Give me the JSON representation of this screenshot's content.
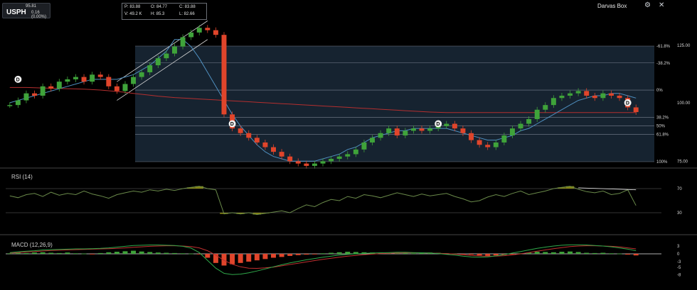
{
  "ticker": {
    "symbol": "USPH",
    "price": "95.81",
    "change": "0.16 (0.00%)"
  },
  "ohlc": {
    "p": "P: 83.88",
    "o": "O: 84.77",
    "c": "C: 83.88",
    "v": "V: 49.2 K",
    "h": "H: 85.3",
    "l": "L: 82.66"
  },
  "toolbar": {
    "indicator_name": "Darvas Box",
    "settings_icon": "gear-icon",
    "close_icon": "close-icon"
  },
  "colors": {
    "background": "#000000",
    "up_candle": "#3fa33a",
    "down_candle": "#e0452b",
    "ma_short": "#4f8fbf",
    "ma_long": "#b42f2f",
    "fib_fill": "#1c2c3c",
    "rsi_line": "#6a8a4a",
    "rsi_fill": "#9a9a16",
    "macd_line": "#2fa84a",
    "signal_line": "#c03030"
  },
  "chart_data": [
    {
      "type": "line",
      "title": "",
      "y_ticks": [
        "125.00",
        "100.00",
        "75.00"
      ],
      "fib_levels": [
        {
          "label": "-61.8%",
          "value": 123.2
        },
        {
          "label": "-38.2%",
          "value": 116.0
        },
        {
          "label": "0%",
          "value": 104.4
        },
        {
          "label": "38.2%",
          "value": 92.7
        },
        {
          "label": "50%",
          "value": 89.1
        },
        {
          "label": "61.8%",
          "value": 85.5
        },
        {
          "label": "100%",
          "value": 73.8
        }
      ],
      "close": [
        98,
        100,
        103,
        102,
        106,
        105,
        108,
        109,
        110,
        108,
        111,
        110,
        106,
        104,
        107,
        110,
        112,
        115,
        118,
        120,
        123,
        127,
        129,
        131,
        130,
        128,
        94,
        88,
        86,
        84,
        82,
        80,
        78,
        76,
        74,
        73,
        72,
        73,
        74,
        75,
        76,
        77,
        79,
        82,
        84,
        86,
        88,
        85,
        87,
        88,
        87,
        88,
        89,
        90,
        88,
        86,
        83,
        81,
        80,
        82,
        85,
        88,
        90,
        92,
        96,
        98,
        101,
        102,
        103,
        104,
        102,
        101,
        103,
        102,
        101,
        97,
        95
      ],
      "ma_short": [
        99,
        100,
        101,
        102,
        103,
        104,
        105,
        106,
        107,
        108,
        109,
        109,
        109,
        109,
        110,
        111,
        113,
        115,
        118,
        121,
        126,
        126,
        123,
        118,
        112,
        106,
        100,
        94,
        89,
        85,
        81,
        78,
        76,
        75,
        74,
        74,
        74,
        74,
        75,
        76,
        77,
        79,
        80,
        82,
        84,
        85,
        86,
        87,
        87,
        88,
        88,
        88,
        88,
        88,
        87,
        86,
        85,
        84,
        83,
        83,
        84,
        85,
        87,
        88,
        90,
        92,
        94,
        96,
        98,
        100,
        101,
        102,
        102,
        103,
        103,
        102,
        101
      ],
      "ma_long": [
        105.5,
        105.5,
        105.5,
        105.4,
        105.3,
        105.2,
        105.1,
        105.0,
        104.9,
        104.8,
        104.6,
        104.4,
        104.1,
        103.8,
        103.4,
        103.0,
        102.6,
        102.2,
        101.8,
        101.5,
        101.2,
        101.0,
        100.8,
        100.6,
        100.4,
        100.2,
        100.0,
        99.8,
        99.6,
        99.4,
        99.2,
        99.0,
        98.8,
        98.6,
        98.4,
        98.2,
        98.0,
        97.8,
        97.6,
        97.4,
        97.2,
        97.0,
        96.8,
        96.6,
        96.4,
        96.2,
        96.0,
        95.8,
        95.6,
        95.4,
        95.2,
        95.0,
        94.9,
        94.8,
        94.8,
        94.8,
        94.8,
        94.8,
        94.8,
        94.8,
        94.8,
        94.8,
        94.8,
        94.8,
        94.8,
        94.8,
        94.8,
        94.8,
        94.8,
        94.8,
        94.8,
        94.8,
        94.8,
        94.8,
        94.8,
        94.8,
        94.8
      ],
      "events": [
        {
          "label": "D",
          "index": 1,
          "value": 109
        },
        {
          "label": "D",
          "index": 27,
          "value": 90
        },
        {
          "label": "D",
          "index": 52,
          "value": 90
        },
        {
          "label": "D",
          "index": 75,
          "value": 99
        }
      ]
    },
    {
      "type": "line",
      "title": "RSI (14)",
      "y_ticks": [
        "70",
        "30"
      ],
      "ylim": [
        20,
        85
      ],
      "values": [
        58,
        55,
        60,
        62,
        57,
        64,
        59,
        62,
        60,
        66,
        61,
        58,
        54,
        60,
        63,
        66,
        64,
        68,
        66,
        69,
        67,
        70,
        72,
        74,
        70,
        68,
        28,
        30,
        28,
        30,
        27,
        29,
        31,
        33,
        30,
        37,
        43,
        40,
        47,
        52,
        50,
        57,
        54,
        60,
        58,
        55,
        59,
        63,
        60,
        57,
        61,
        58,
        60,
        62,
        57,
        53,
        48,
        50,
        56,
        60,
        57,
        62,
        66,
        60,
        63,
        66,
        70,
        72,
        74,
        69,
        65,
        63,
        66,
        60,
        62,
        68,
        42
      ],
      "rsi_high_trend": {
        "from_index": 69,
        "to_index": 76
      }
    },
    {
      "type": "bar",
      "title": "MACD (12,26,9)",
      "y_ticks": [
        "3",
        "0",
        "-3",
        "-5",
        "-8"
      ],
      "ylim": [
        -9,
        4.5
      ],
      "histogram": [
        0.2,
        0.4,
        0.3,
        0.5,
        0.6,
        0.4,
        0.3,
        0.5,
        0.2,
        0.1,
        -0.2,
        0.3,
        0.6,
        0.8,
        1.0,
        1.2,
        0.9,
        0.7,
        0.5,
        0.4,
        0.3,
        0.2,
        0.1,
        -0.2,
        -1.5,
        -3.5,
        -4.5,
        -4.0,
        -3.5,
        -3.0,
        -2.5,
        -2.0,
        -1.5,
        -1.2,
        -0.8,
        -0.5,
        -0.3,
        -0.2,
        0.2,
        0.4,
        0.6,
        0.8,
        0.7,
        0.6,
        0.5,
        0.4,
        0.3,
        0.5,
        0.4,
        0.2,
        0.3,
        0.5,
        0.4,
        0.2,
        0.1,
        -0.1,
        -0.3,
        -0.6,
        -0.8,
        -0.6,
        -0.4,
        -0.2,
        0.2,
        0.5,
        0.8,
        0.7,
        0.6,
        0.8,
        0.9,
        0.7,
        0.4,
        0.3,
        0.4,
        0.2,
        0.1,
        -0.3,
        -0.6
      ],
      "macd": [
        0.5,
        0.8,
        1.0,
        1.2,
        1.5,
        1.6,
        1.7,
        1.8,
        1.9,
        1.9,
        2.0,
        2.1,
        2.3,
        2.6,
        2.9,
        3.2,
        3.3,
        3.4,
        3.4,
        3.3,
        3.2,
        2.9,
        2.2,
        0.5,
        -2.5,
        -5.5,
        -7.5,
        -8.0,
        -7.8,
        -7.3,
        -6.6,
        -5.8,
        -5.0,
        -4.2,
        -3.5,
        -2.9,
        -2.3,
        -1.8,
        -1.3,
        -0.9,
        -0.5,
        -0.2,
        0.0,
        0.2,
        0.3,
        0.4,
        0.5,
        0.6,
        0.6,
        0.5,
        0.4,
        0.3,
        0.1,
        -0.2,
        -0.5,
        -0.9,
        -1.2,
        -1.3,
        -1.2,
        -0.8,
        -0.3,
        0.3,
        0.9,
        1.5,
        2.1,
        2.6,
        3.0,
        3.3,
        3.5,
        3.5,
        3.4,
        3.2,
        3.0,
        2.7,
        2.3,
        1.8,
        1.2
      ],
      "signal": [
        0.3,
        0.5,
        0.7,
        0.9,
        1.1,
        1.3,
        1.4,
        1.5,
        1.6,
        1.7,
        1.8,
        1.9,
        2.0,
        2.1,
        2.3,
        2.5,
        2.7,
        2.9,
        3.0,
        3.1,
        3.1,
        3.0,
        2.8,
        2.3,
        1.2,
        -0.5,
        -2.5,
        -4.0,
        -5.0,
        -5.5,
        -5.6,
        -5.4,
        -5.1,
        -4.6,
        -4.1,
        -3.6,
        -3.1,
        -2.6,
        -2.1,
        -1.7,
        -1.3,
        -0.9,
        -0.6,
        -0.3,
        -0.1,
        0.1,
        0.2,
        0.3,
        0.4,
        0.4,
        0.4,
        0.3,
        0.2,
        0.1,
        -0.1,
        -0.3,
        -0.6,
        -0.8,
        -0.9,
        -0.9,
        -0.7,
        -0.4,
        0.0,
        0.5,
        1.0,
        1.5,
        2.0,
        2.4,
        2.8,
        3.0,
        3.1,
        3.1,
        3.0,
        2.9,
        2.7,
        2.3,
        1.9
      ]
    }
  ]
}
